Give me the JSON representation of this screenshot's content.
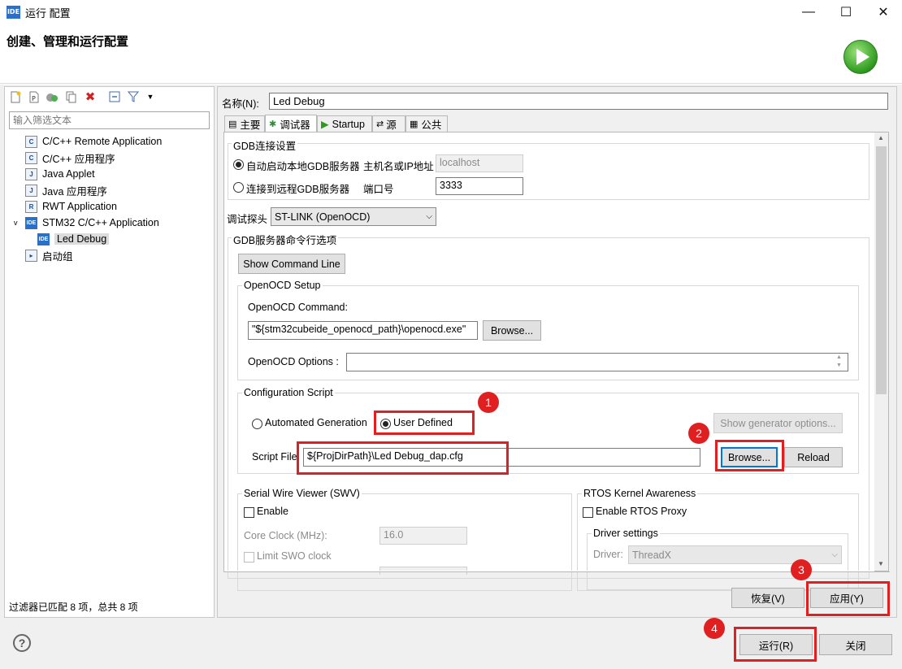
{
  "window": {
    "app_icon": "IDE",
    "title": "运行 配置",
    "minimize": "—",
    "maximize": "☐",
    "close": "✕"
  },
  "header": {
    "title": "创建、管理和运行配置"
  },
  "left": {
    "filter_placeholder": "输入筛选文本",
    "tree": [
      {
        "label": "C/C++ Remote Application",
        "icon": "c-icon"
      },
      {
        "label": "C/C++ 应用程序",
        "icon": "c-icon"
      },
      {
        "label": "Java Applet",
        "icon": "java-applet-icon"
      },
      {
        "label": "Java 应用程序",
        "icon": "java-icon"
      },
      {
        "label": "RWT Application",
        "icon": "rwt-icon"
      },
      {
        "label": "STM32 C/C++ Application",
        "icon": "ide-icon"
      },
      {
        "label": "Led Debug",
        "icon": "ide-icon"
      },
      {
        "label": "启动组",
        "icon": "launch-group-icon"
      }
    ],
    "status": "过滤器已匹配 8 项，总共 8 项"
  },
  "config": {
    "name_label": "名称(N):",
    "name_value": "Led Debug",
    "tabs": [
      "主要",
      "调试器",
      "Startup",
      "源",
      "公共"
    ],
    "gdb": {
      "group_title": "GDB连接设置",
      "local_label": "自动启动本地GDB服务器",
      "host_label": "主机名或IP地址",
      "host_value": "localhost",
      "remote_label": "连接到远程GDB服务器",
      "port_label": "端口号",
      "port_value": "3333"
    },
    "probe_label": "调试探头",
    "probe_value": "ST-LINK (OpenOCD)",
    "server": {
      "group_title": "GDB服务器命令行选项",
      "show_cmd_button": "Show Command Line",
      "openocd_group": "OpenOCD Setup",
      "openocd_cmd_label": "OpenOCD Command:",
      "openocd_cmd_value": "\"${stm32cubeide_openocd_path}\\openocd.exe\"",
      "browse": "Browse...",
      "openocd_opts_label": "OpenOCD Options :",
      "openocd_opts_value": ""
    },
    "script": {
      "group_title": "Configuration Script",
      "auto_label": "Automated Generation",
      "user_label": "User Defined",
      "show_gen_button": "Show generator options...",
      "file_label": "Script File",
      "file_value": "${ProjDirPath}\\Led Debug_dap.cfg",
      "browse": "Browse...",
      "reload": "Reload"
    },
    "swv": {
      "group_title": "Serial Wire Viewer (SWV)",
      "enable_label": "Enable",
      "core_clock_label": "Core Clock (MHz):",
      "core_clock_value": "16.0",
      "limit_label": "Limit SWO clock"
    },
    "rtos": {
      "group_title": "RTOS Kernel Awareness",
      "enable_label": "Enable RTOS Proxy",
      "driver_group": "Driver settings",
      "driver_label": "Driver:",
      "driver_value": "ThreadX"
    },
    "revert_button": "恢复(V)",
    "apply_button": "应用(Y)"
  },
  "footer": {
    "help": "?",
    "run_button": "运行(R)",
    "close_button": "关闭"
  },
  "annotations": [
    "1",
    "2",
    "3",
    "4"
  ],
  "colors": {
    "annotation_red": "#e02020",
    "ide_blue": "#2a6fc9",
    "focus_blue": "#0078d7",
    "run_green": "#2e9a1f"
  }
}
